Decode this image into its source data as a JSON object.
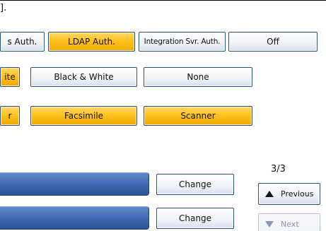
{
  "header": {
    "clipped_text": "]."
  },
  "auth_row": {
    "buttons": [
      {
        "label": "s Auth.",
        "selected": false
      },
      {
        "label": "LDAP Auth.",
        "selected": true
      },
      {
        "label": "Integration Svr. Auth.",
        "selected": false
      },
      {
        "label": "Off",
        "selected": false
      }
    ]
  },
  "color_row": {
    "buttons": [
      {
        "label": "ite",
        "selected": true
      },
      {
        "label": "Black & White",
        "selected": false
      },
      {
        "label": "None",
        "selected": false
      }
    ]
  },
  "function_row": {
    "buttons": [
      {
        "label": "r",
        "selected": true
      },
      {
        "label": "Facsimile",
        "selected": true
      },
      {
        "label": "Scanner",
        "selected": true
      }
    ]
  },
  "settings_list": {
    "change_label": "Change"
  },
  "pagination": {
    "page_indicator": "3/3",
    "previous_label": "Previous",
    "next_label": "Next"
  },
  "colors": {
    "selected": "#ffc21f",
    "blue_bar": "#3f67ae",
    "border": "#2b4f88"
  }
}
